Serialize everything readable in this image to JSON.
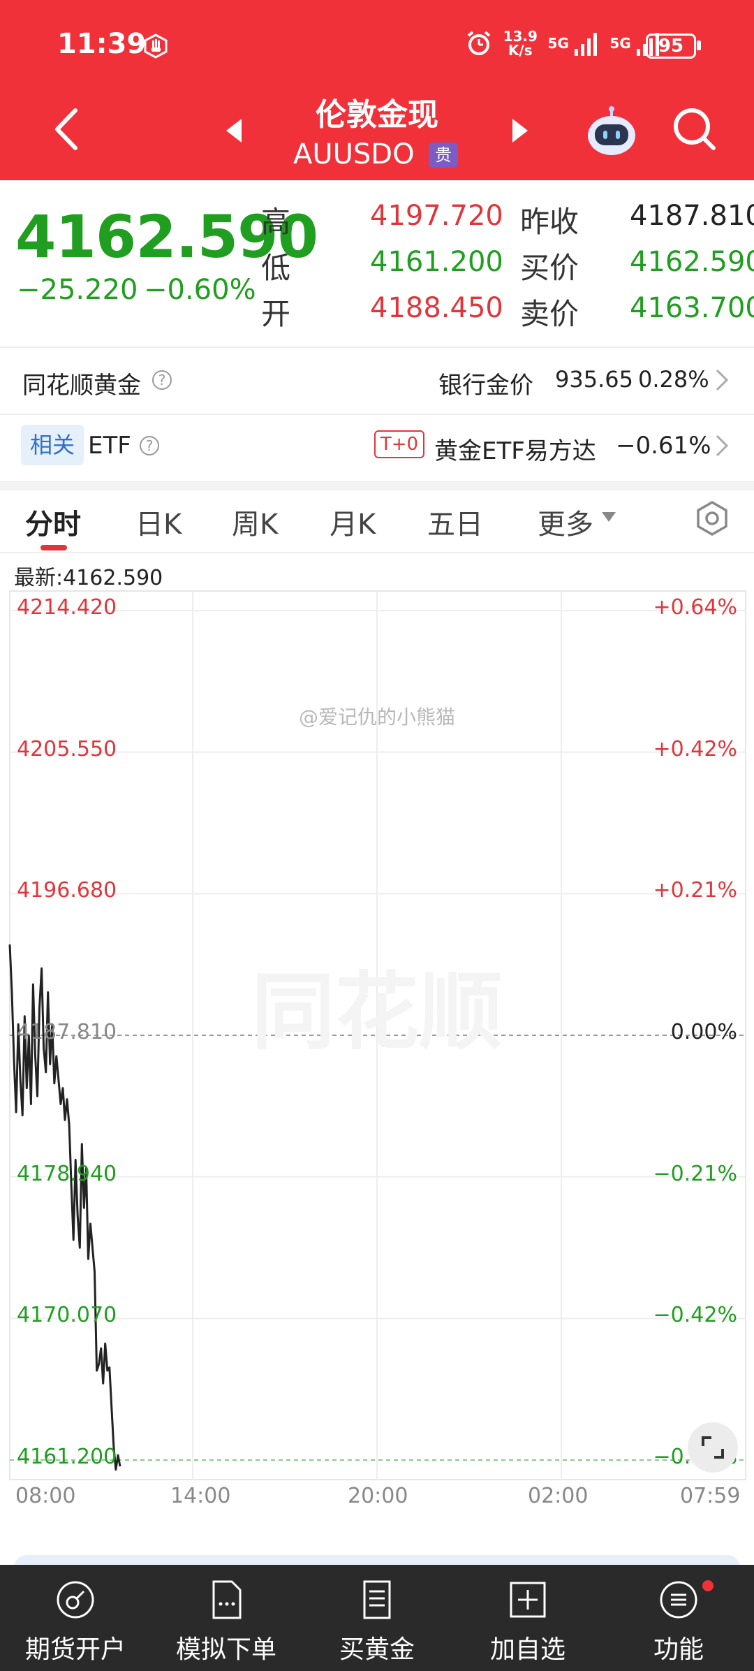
{
  "status": {
    "time": "11:39",
    "speed": "13.9",
    "speed_unit": "K/s",
    "net1": "5G",
    "net2": "5G",
    "battery": "95"
  },
  "header": {
    "title": "伦敦金现",
    "code": "AUUSDO",
    "badge": "贵"
  },
  "quote": {
    "price": "4162.590",
    "change": "−25.220",
    "change_pct": "−0.60%",
    "high_label": "高",
    "high": "4197.720",
    "low_label": "低",
    "low": "4161.200",
    "open_label": "开",
    "open": "4188.450",
    "prev_close_label": "昨收",
    "prev_close": "4187.810",
    "bid_label": "买价",
    "bid": "4162.590",
    "ask_label": "卖价",
    "ask": "4163.700"
  },
  "gold_row": {
    "label": "同花顺黄金",
    "bank_label": "银行金价",
    "bank_price": "935.65",
    "bank_pct": "0.28%"
  },
  "etf_row": {
    "tag": "相关",
    "label": "ETF",
    "badge": "T+0",
    "name": "黄金ETF易方达",
    "pct": "−0.61%"
  },
  "tabs": [
    "分时",
    "日K",
    "周K",
    "月K",
    "五日",
    "更多"
  ],
  "latest": "最新:4162.590",
  "watermark": {
    "handle": "@爱记仇的小熊猫",
    "brand": "同花顺"
  },
  "chart_data": {
    "type": "line",
    "y_left_labels": [
      "4214.420",
      "4205.550",
      "4196.680",
      "4187.810",
      "4178.940",
      "4170.070",
      "4161.200"
    ],
    "y_right_labels": [
      "+0.64%",
      "+0.42%",
      "+0.21%",
      "0.00%",
      "−0.21%",
      "−0.42%",
      "−0.64%"
    ],
    "x_labels": [
      "08:00",
      "14:00",
      "20:00",
      "02:00",
      "07:59"
    ],
    "ylim": [
      4161.2,
      4214.42
    ],
    "prev_close": 4187.81,
    "series": [
      {
        "values": [
          4193.5,
          4190.5,
          4186.2,
          4183.0,
          4188.5,
          4185.0,
          4182.8,
          4189.0,
          4184.5,
          4187.8,
          4183.5,
          4191.0,
          4186.5,
          4184.0,
          4189.5,
          4192.0,
          4187.0,
          4185.5,
          4190.5,
          4186.0,
          4188.5,
          4184.8,
          4186.5,
          4185.0,
          4183.5,
          4184.5,
          4182.5,
          4183.8,
          4182.2,
          4178.5,
          4175.0,
          4180.0,
          4176.5,
          4174.5,
          4181.0,
          4177.0,
          4179.5,
          4173.8,
          4176.0,
          4174.5,
          4173.0,
          4166.8,
          4167.2,
          4168.2,
          4166.0,
          4168.5,
          4166.8,
          4167.0,
          4164.5,
          4162.0,
          4160.6,
          4161.5,
          4160.8
        ]
      }
    ]
  },
  "nav": [
    "期货开户",
    "模拟下单",
    "买黄金",
    "加自选",
    "功能"
  ],
  "colors": {
    "header": "#f0313a",
    "up": "#e0363b",
    "down": "#1f9e1f",
    "line": "#222222",
    "nav_bg": "#2a2a2a"
  }
}
